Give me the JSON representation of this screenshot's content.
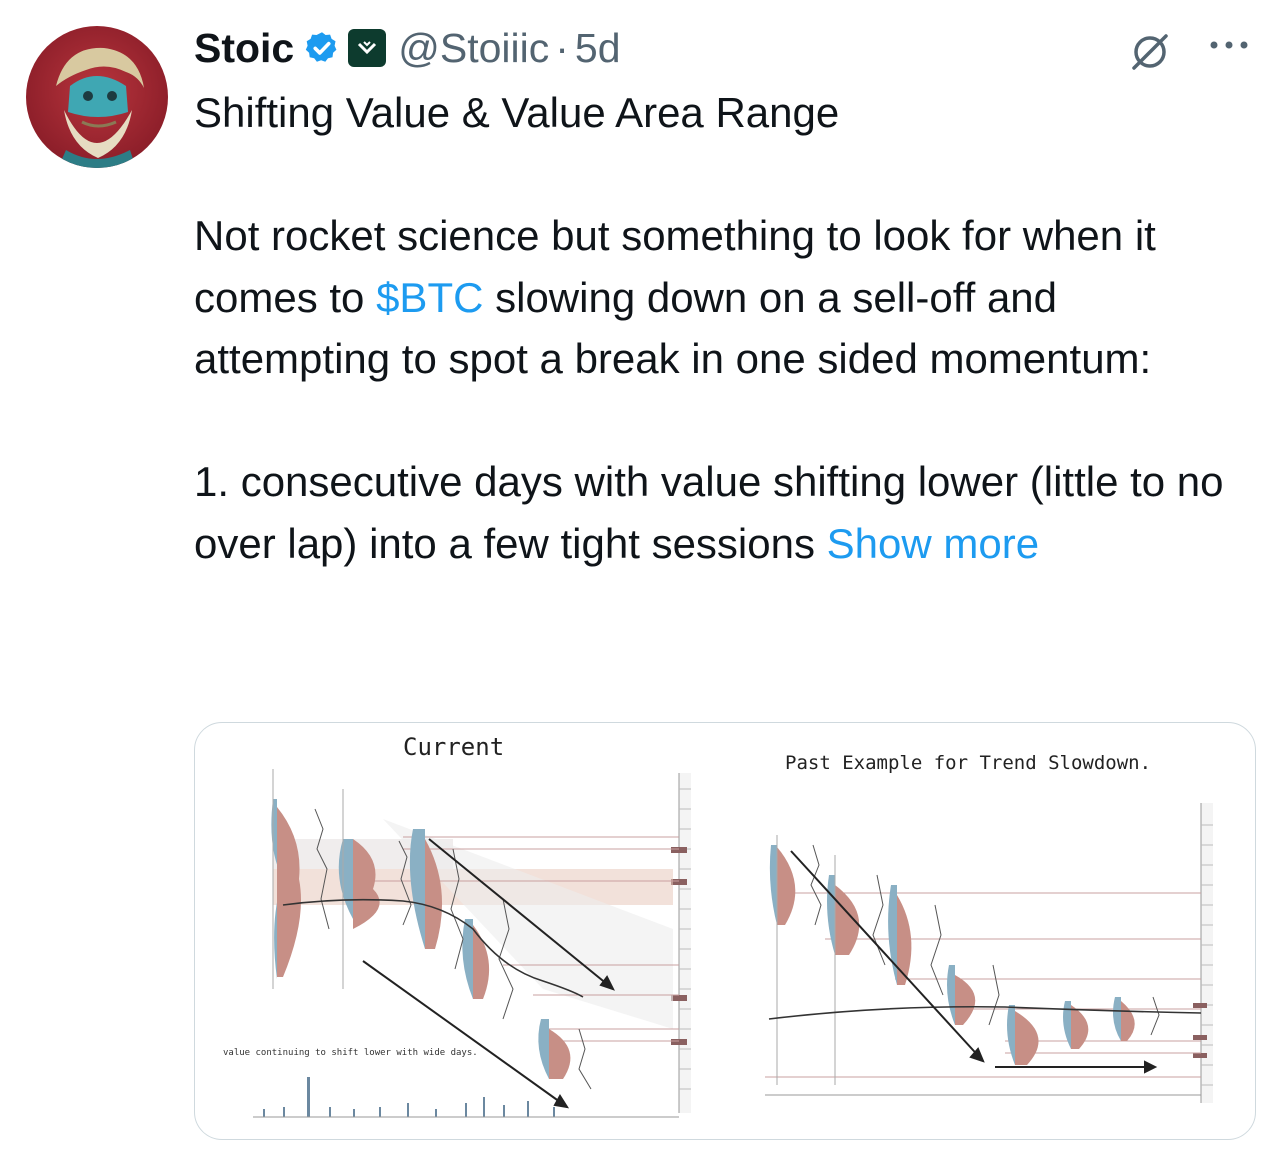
{
  "tweet": {
    "author_name": "Stoic",
    "handle": "@Stoiiic",
    "separator": "·",
    "time": "5d",
    "line1": "Shifting Value & Value Area Range",
    "p1_a": "Not rocket science but something to look for when it comes to ",
    "cashtag": "$BTC",
    "p1_b": " slowing down on a sell-off and attempting to spot a break in one sided momentum:",
    "p2": "1.  consecutive days with value shifting lower (little to no over lap) into a few tight sessions ",
    "show_more": "Show more"
  },
  "media": {
    "left_title": "Current",
    "left_caption": "value continuing to shift lower with wide days.",
    "right_title": "Past Example for Trend Slowdown."
  },
  "icons": {
    "verified": "verified-badge-icon",
    "affiliate": "affiliate-badge-icon",
    "grok": "grok-icon",
    "more": "more-icon"
  },
  "colors": {
    "link": "#1d9bf0",
    "verified": "#1d9bf0",
    "text": "#0f1419",
    "secondary": "#536471"
  }
}
